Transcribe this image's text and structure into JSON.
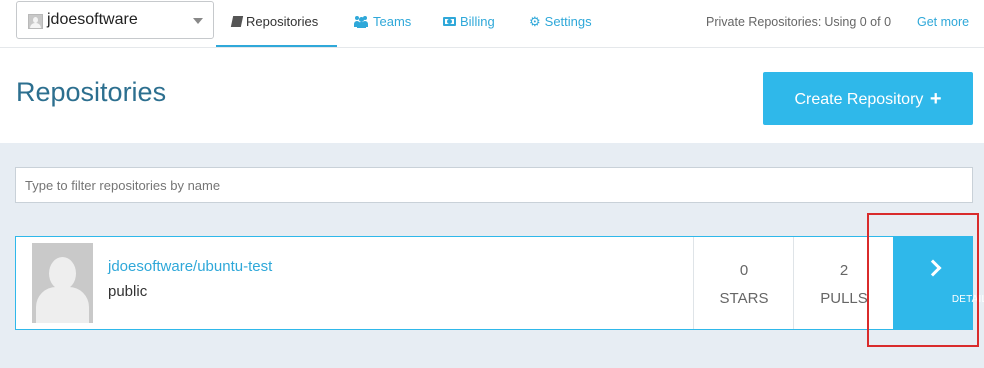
{
  "account": {
    "name": "jdoesoftware"
  },
  "nav": {
    "tabs": [
      {
        "label": "Repositories",
        "icon": "book-icon",
        "active": true
      },
      {
        "label": "Teams",
        "icon": "users-icon",
        "active": false
      },
      {
        "label": "Billing",
        "icon": "money-icon",
        "active": false
      },
      {
        "label": "Settings",
        "icon": "gear-icon",
        "active": false
      }
    ]
  },
  "plan": {
    "label": "Private Repositories:",
    "value": "Using 0 of 0",
    "link": "Get more"
  },
  "page": {
    "title": "Repositories",
    "create_label": "Create Repository",
    "create_icon": "+"
  },
  "filter": {
    "placeholder": "Type to filter repositories by name",
    "value": ""
  },
  "repos": [
    {
      "name": "jdoesoftware/ubuntu-test",
      "visibility": "public",
      "stars": "0",
      "stars_label": "STARS",
      "pulls": "2",
      "pulls_label": "PULLS",
      "details_label": "DETAILS"
    }
  ],
  "colors": {
    "accent": "#2fb8ea",
    "title": "#2c6f8f",
    "highlight": "#d92b2b"
  }
}
